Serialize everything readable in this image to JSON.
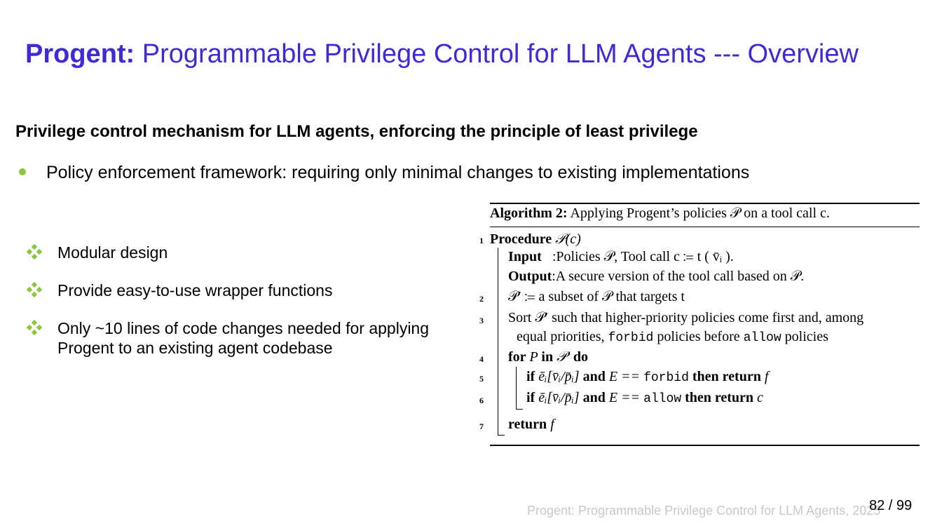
{
  "slide": {
    "title_bold": "Progent:",
    "title_rest": " Programmable Privilege Control for LLM Agents --- Overview",
    "subtitle": "Privilege control mechanism for LLM agents, enforcing the principle of least privilege",
    "bullet": "Policy enforcement framework: requiring only minimal changes to existing implementations",
    "sub_items": [
      {
        "text": "Modular design"
      },
      {
        "text": "Provide easy-to-use wrapper functions"
      },
      {
        "text": "Only ~10 lines of code changes needed for applying Progent to an existing agent codebase"
      }
    ],
    "accent_color": "#3f2bd6",
    "bullet_color": "#8dc63f"
  },
  "algorithm": {
    "caption_label": "Algorithm 2:",
    "caption_text": " Applying Progent’s policies 𝒫 on a tool call c.",
    "line_numbers": [
      "1",
      "2",
      "3",
      "4",
      "5",
      "6",
      "7"
    ],
    "procedure_kw": "Procedure",
    "procedure_sig": " 𝒫(c)",
    "input_kw": "Input",
    "input_text": ":Policies 𝒫, Tool call c ≔ t ( v̄ᵢ ).",
    "output_kw": "Output",
    "output_text": ":A secure version of the tool call based on 𝒫.",
    "line2": "𝒫′ ≔ a subset of 𝒫 that targets t",
    "line3a": "Sort 𝒫′ such that higher-priority policies come first and, among",
    "line3b_pre": "equal priorities, ",
    "line3b_forbid": "forbid",
    "line3b_mid": " policies before ",
    "line3b_allow": "allow",
    "line3b_post": " policies",
    "for_kw": "for",
    "for_var": " P ",
    "in_kw": "in",
    "for_set": " 𝒫′ ",
    "do_kw": "do",
    "if_kw": "if",
    "cond": " ēᵢ[v̄ᵢ/p̄ᵢ] ",
    "and_kw": "and",
    "eq": " E == ",
    "forbid": "forbid",
    "allow": "allow",
    "then_return_kw": " then return",
    "ret_f": " f",
    "ret_c": " c",
    "return_kw": "return"
  },
  "footer": {
    "citation": "Progent: Programmable Privilege Control for LLM Agents, 2025",
    "page": "82 / 99"
  }
}
